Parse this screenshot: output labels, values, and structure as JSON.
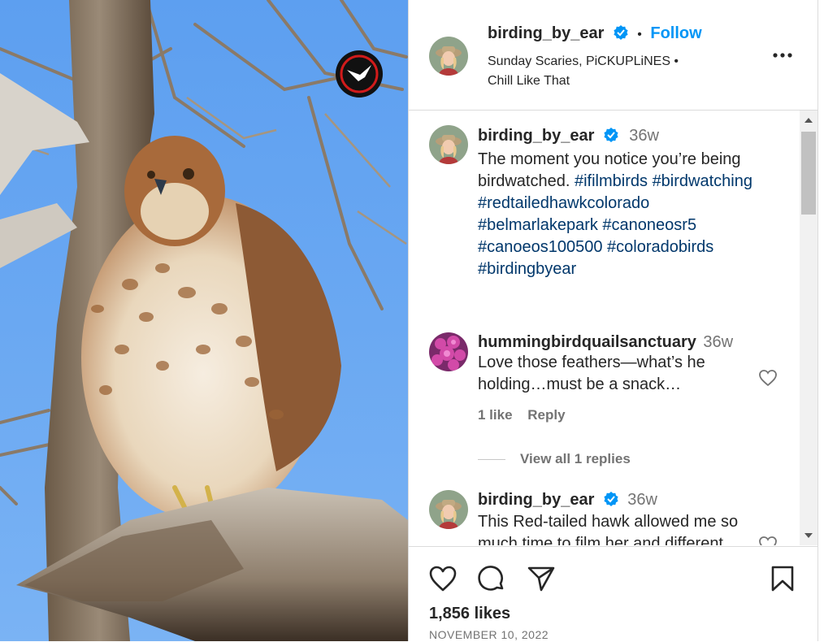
{
  "post": {
    "username": "birding_by_ear",
    "follow_label": "Follow",
    "separator": "•",
    "audio_line1": "Sunday Scaries, PiCKUPLiNES •",
    "audio_line2": "Chill Like That",
    "more_icon": "more-horizontal-icon"
  },
  "caption": {
    "username": "birding_by_ear",
    "age": "36w",
    "text": "The moment you notice you’re being birdwatched.",
    "hashtags": [
      "#ifilmbirds",
      "#birdwatching",
      "#redtailedhawkcolorado",
      "#belmarlakepark",
      "#canoneosr5",
      "#canoeos100500",
      "#coloradobirds",
      "#birdingbyear"
    ]
  },
  "comments": [
    {
      "username": "hummingbirdquailsanctuary",
      "age": "36w",
      "text_line1": "Love those feathers—what’s he",
      "text_line2": "holding…must be a snack…",
      "likes": "1 like",
      "reply_label": "Reply",
      "view_replies": "View all 1 replies"
    },
    {
      "username": "birding_by_ear",
      "age": "36w",
      "text_line1": "This Red-tailed hawk allowed me so",
      "text_line2": "much time to film her and different"
    }
  ],
  "footer": {
    "likes": "1,856 likes",
    "date": "NOVEMBER 10, 2022"
  },
  "colors": {
    "accent": "#0095f6",
    "hashtag": "#00376b",
    "verified": "#0095f6",
    "sky": "#6aa8f2"
  }
}
